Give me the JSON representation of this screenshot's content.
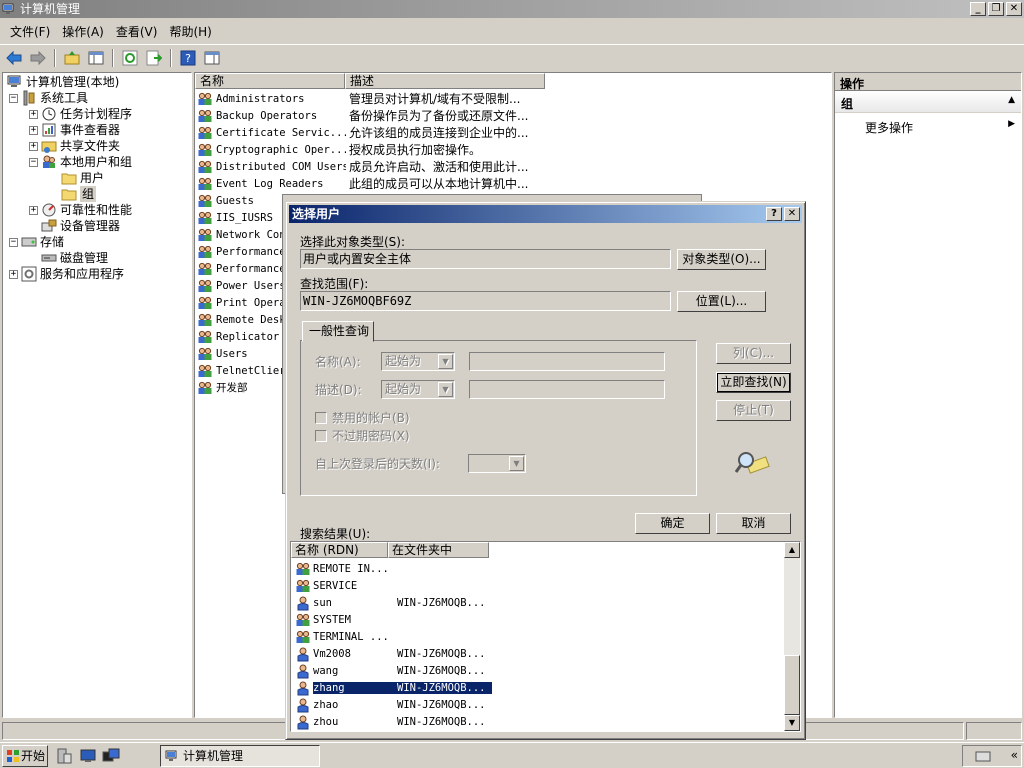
{
  "window": {
    "title": "计算机管理",
    "controls": [
      "_",
      "❐",
      "✕"
    ]
  },
  "menu": [
    "文件(F)",
    "操作(A)",
    "查看(V)",
    "帮助(H)"
  ],
  "tree": {
    "items": [
      {
        "label": "计算机管理(本地)",
        "level": 0,
        "expander": "",
        "icon": "computer-icon"
      },
      {
        "label": "系统工具",
        "level": 1,
        "expander": "−",
        "icon": "tools-icon"
      },
      {
        "label": "任务计划程序",
        "level": 2,
        "expander": "+",
        "icon": "clock-icon"
      },
      {
        "label": "事件查看器",
        "level": 2,
        "expander": "+",
        "icon": "event-viewer-icon"
      },
      {
        "label": "共享文件夹",
        "level": 2,
        "expander": "+",
        "icon": "shared-folder-icon"
      },
      {
        "label": "本地用户和组",
        "level": 2,
        "expander": "−",
        "icon": "users-icon"
      },
      {
        "label": "用户",
        "level": 3,
        "expander": "",
        "icon": "folder-icon"
      },
      {
        "label": "组",
        "level": 3,
        "expander": "",
        "icon": "folder-icon",
        "selected": true
      },
      {
        "label": "可靠性和性能",
        "level": 2,
        "expander": "+",
        "icon": "performance-icon"
      },
      {
        "label": "设备管理器",
        "level": 2,
        "expander": "",
        "icon": "device-manager-icon"
      },
      {
        "label": "存储",
        "level": 1,
        "expander": "−",
        "icon": "storage-icon"
      },
      {
        "label": "磁盘管理",
        "level": 2,
        "expander": "",
        "icon": "disk-icon"
      },
      {
        "label": "服务和应用程序",
        "level": 1,
        "expander": "+",
        "icon": "services-icon"
      }
    ]
  },
  "list": {
    "columns": [
      "名称",
      "描述"
    ],
    "rows": [
      {
        "name": "Administrators",
        "desc": "管理员对计算机/域有不受限制..."
      },
      {
        "name": "Backup Operators",
        "desc": "备份操作员为了备份或还原文件..."
      },
      {
        "name": "Certificate Servic...",
        "desc": "允许该组的成员连接到企业中的..."
      },
      {
        "name": "Cryptographic Oper...",
        "desc": "授权成员执行加密操作。"
      },
      {
        "name": "Distributed COM Users",
        "desc": "成员允许启动、激活和使用此计..."
      },
      {
        "name": "Event Log Readers",
        "desc": "此组的成员可以从本地计算机中..."
      },
      {
        "name": "Guests",
        "desc": ""
      },
      {
        "name": "IIS_IUSRS",
        "desc": ""
      },
      {
        "name": "Network Con",
        "desc": ""
      },
      {
        "name": "Performance",
        "desc": ""
      },
      {
        "name": "Performance",
        "desc": ""
      },
      {
        "name": "Power Users",
        "desc": ""
      },
      {
        "name": "Print Opera",
        "desc": ""
      },
      {
        "name": "Remote Desk",
        "desc": ""
      },
      {
        "name": "Replicator",
        "desc": ""
      },
      {
        "name": "Users",
        "desc": ""
      },
      {
        "name": "TelnetClier",
        "desc": ""
      },
      {
        "name": "开发部",
        "desc": ""
      }
    ]
  },
  "actions": {
    "header": "操作",
    "section": "组",
    "more": "更多操作"
  },
  "dialog": {
    "title": "选择用户",
    "help_btn": "?",
    "close_btn": "✕",
    "object_type_label": "选择此对象类型(S):",
    "object_type_value": "用户或内置安全主体",
    "object_type_button": "对象类型(O)...",
    "location_label": "查找范围(F):",
    "location_value": "WIN-JZ6MOQBF69Z",
    "location_button": "位置(L)...",
    "tab_label": "一般性查询",
    "name_label": "名称(A):",
    "name_mode": "起始为",
    "desc_label": "描述(D):",
    "desc_mode": "起始为",
    "disabled_accounts": "禁用的帐户(B)",
    "non_expiring_pw": "不过期密码(X)",
    "days_since_logon": "自上次登录后的天数(I):",
    "columns_button": "列(C)...",
    "find_now_button": "立即查找(N)",
    "stop_button": "停止(T)",
    "ok_button": "确定",
    "cancel_button": "取消",
    "results_label": "搜索结果(U):",
    "results_columns": [
      "名称 (RDN)",
      "在文件夹中"
    ],
    "results": [
      {
        "name": "REMOTE IN...",
        "folder": "",
        "icon": "group-icon"
      },
      {
        "name": "SERVICE",
        "folder": "",
        "icon": "group-icon"
      },
      {
        "name": "sun",
        "folder": "WIN-JZ6MOQB...",
        "icon": "user-icon"
      },
      {
        "name": "SYSTEM",
        "folder": "",
        "icon": "group-icon"
      },
      {
        "name": "TERMINAL ...",
        "folder": "",
        "icon": "group-icon"
      },
      {
        "name": "Vm2008",
        "folder": "WIN-JZ6MOQB...",
        "icon": "user-icon"
      },
      {
        "name": "wang",
        "folder": "WIN-JZ6MOQB...",
        "icon": "user-icon"
      },
      {
        "name": "zhang",
        "folder": "WIN-JZ6MOQB...",
        "icon": "user-icon",
        "selected": true
      },
      {
        "name": "zhao",
        "folder": "WIN-JZ6MOQB...",
        "icon": "user-icon"
      },
      {
        "name": "zhou",
        "folder": "WIN-JZ6MOQB...",
        "icon": "user-icon"
      }
    ]
  },
  "taskbar": {
    "start": "开始",
    "task_item": "计算机管理"
  },
  "colors": {
    "selection": "#0a246a",
    "face": "#d4d0c8"
  }
}
